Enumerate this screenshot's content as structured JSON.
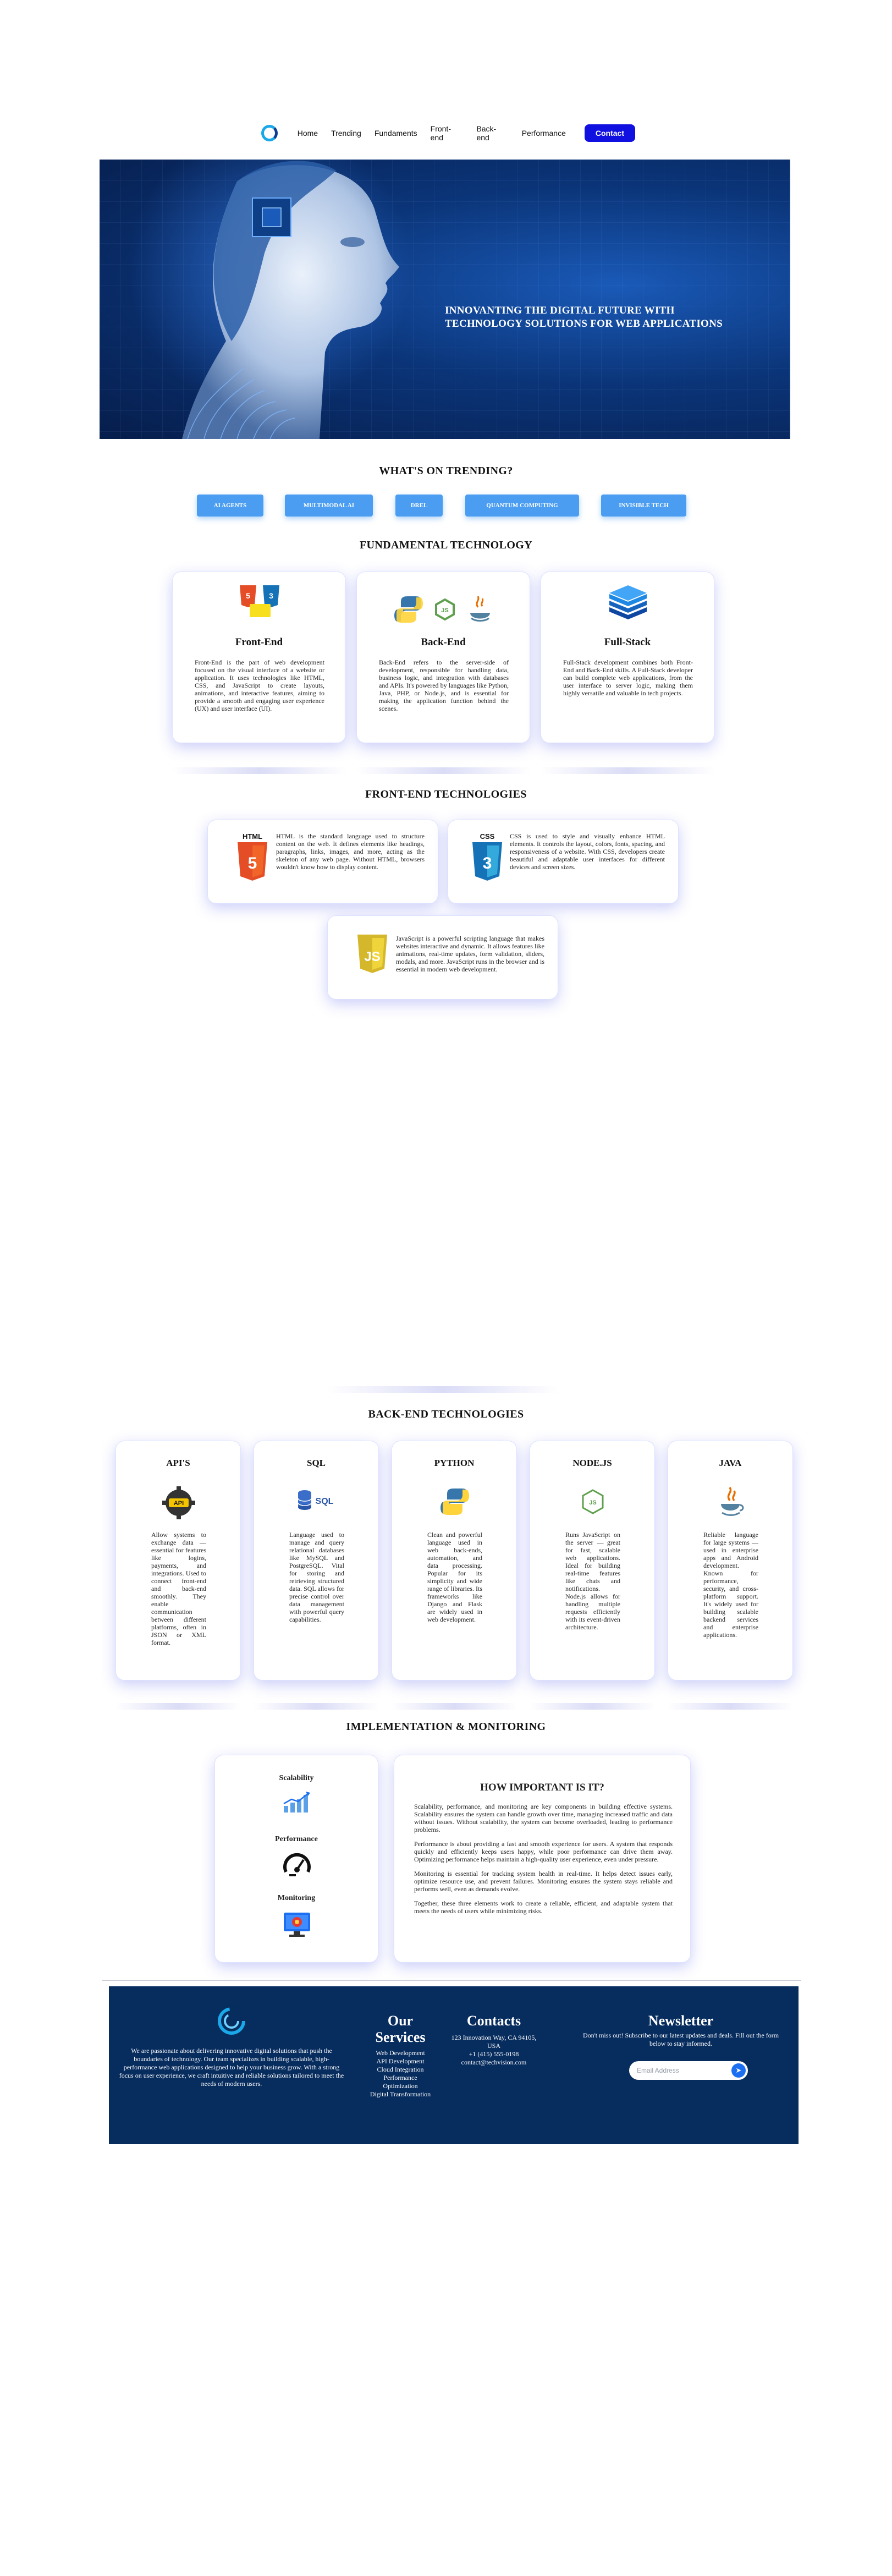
{
  "nav": {
    "links": [
      "Home",
      "Trending",
      "Fundaments",
      "Front-end",
      "Back-end",
      "Performance"
    ],
    "contact": "Contact"
  },
  "hero": {
    "title": "INNOVANTING THE DIGITAL FUTURE WITH TECHNOLOGY SOLUTIONS FOR WEB APPLICATIONS"
  },
  "trending": {
    "title": "WHAT'S ON TRENDING?",
    "tags": [
      "AI AGENTS",
      "MULTIMODAL AI",
      "DREL",
      "QUANTUM COMPUTING",
      "INVISIBLE TECH"
    ]
  },
  "fundamental": {
    "title": "FUNDAMENTAL TECHNOLOGY",
    "cards": [
      {
        "title": "Front-End",
        "text": "Front-End is the part of web development focused on the visual interface of a website or application. It uses technologies like HTML, CSS, and JavaScript to create layouts, animations, and interactive features, aiming to provide a smooth and engaging user experience (UX) and user interface (UI)."
      },
      {
        "title": "Back-End",
        "text": "Back-End refers to the server-side of development, responsible for handling data, business logic, and integration with databases and APIs. It's powered by languages like Python, Java, PHP, or Node.js, and is essential for making the application function behind the scenes."
      },
      {
        "title": "Full-Stack",
        "text": "Full-Stack development combines both Front-End and Back-End skills. A Full-Stack developer can build complete web applications, from the user interface to server logic, making them highly versatile and valuable in tech projects."
      }
    ]
  },
  "frontend": {
    "title": "FRONT-END TECHNOLOGIES",
    "items": [
      {
        "label": "HTML",
        "text": "HTML is the standard language used to structure content on the web. It defines elements like headings, paragraphs, links, images, and more, acting as the skeleton of any web page. Without HTML, browsers wouldn't know how to display content."
      },
      {
        "label": "CSS",
        "text": "CSS is used to style and visually enhance HTML elements. It controls the layout, colors, fonts, spacing, and responsiveness of a website. With CSS, developers create beautiful and adaptable user interfaces for different devices and screen sizes."
      },
      {
        "label": "JS",
        "text": "JavaScript is a powerful scripting language that makes websites interactive and dynamic. It allows features like animations, real-time updates, form validation, sliders, modals, and more. JavaScript runs in the browser and is essential in modern web development."
      }
    ]
  },
  "backend": {
    "title": "BACK-END TECHNOLOGIES",
    "cards": [
      {
        "title": "API'S",
        "icon": "api-icon",
        "text": "Allow systems to exchange data — essential for features like logins, payments, and integrations. Used to connect front-end and back-end smoothly. They enable communication between different platforms, often in JSON or XML format."
      },
      {
        "title": "SQL",
        "icon": "sql-icon",
        "text": "Language used to manage and query relational databases like MySQL and PostgreSQL. Vital for storing and retrieving structured data. SQL allows for precise control over data management with powerful query capabilities."
      },
      {
        "title": "PYTHON",
        "icon": "python-icon",
        "text": "Clean and powerful language used in web back-ends, automation, and data processing. Popular for its simplicity and wide range of libraries. Its frameworks like Django and Flask are widely used in web development."
      },
      {
        "title": "NODE.JS",
        "icon": "nodejs-icon",
        "text": "Runs JavaScript on the server — great for fast, scalable web applications. Ideal for building real-time features like chats and notifications. Node.js allows for handling multiple requests efficiently with its event-driven architecture."
      },
      {
        "title": "JAVA",
        "icon": "java-icon",
        "text": "Reliable language for large systems — used in enterprise apps and Android development. Known for performance, security, and cross-platform support. It's widely used for building scalable backend services and enterprise applications."
      }
    ]
  },
  "implementation": {
    "title": "IMPLEMENTATION & MONITORING",
    "labels": [
      "Scalability",
      "Performance",
      "Monitoring"
    ],
    "heading": "HOW IMPORTANT IS IT?",
    "paragraphs": [
      "Scalability, performance, and monitoring are key components in building effective systems. Scalability ensures the system can handle growth over time, managing increased traffic and data without issues. Without scalability, the system can become overloaded, leading to performance problems.",
      "Performance is about providing a fast and smooth experience for users. A system that responds quickly and efficiently keeps users happy, while poor performance can drive them away. Optimizing performance helps maintain a high-quality user experience, even under pressure.",
      "Monitoring is essential for tracking system health in real-time. It helps detect issues early, optimize resource use, and prevent failures. Monitoring ensures the system stays reliable and performs well, even as demands evolve.",
      "Together, these three elements work to create a reliable, efficient, and adaptable system that meets the needs of users while minimizing risks."
    ]
  },
  "footer": {
    "about": "We are passionate about delivering innovative digital solutions that push the boundaries of technology. Our team specializes in building scalable, high-performance web applications designed to help your business grow. With a strong focus on user experience, we craft intuitive and reliable solutions tailored to meet the needs of modern users.",
    "services_title": "Our Services",
    "services": [
      "Web Development",
      "API Development",
      "Cloud Integration",
      "Performance Optimization",
      "Digital Transformation"
    ],
    "contacts_title": "Contacts",
    "contacts": [
      "123 Innovation Way, CA 94105, USA",
      "+1 (415) 555-0198",
      "contact@techvision.com"
    ],
    "newsletter_title": "Newsletter",
    "newsletter_text": "Don't miss out! Subscribe to our latest updates and deals. Fill out the form below to stay informed.",
    "email_placeholder": "Email Address"
  }
}
